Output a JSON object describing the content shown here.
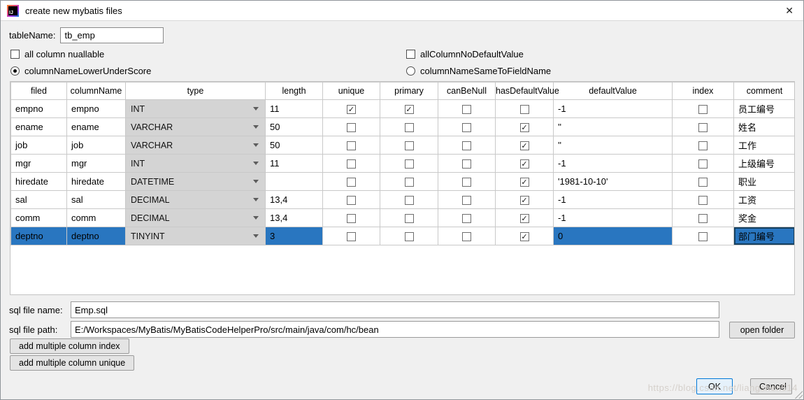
{
  "window": {
    "title": "create new mybatis files",
    "close_glyph": "✕"
  },
  "form": {
    "table_name_label": "tableName:",
    "table_name_value": "tb_emp",
    "options": {
      "all_nullable": "all column nuallable",
      "no_default": "allColumnNoDefaultValue",
      "lower_underscore": "columnNameLowerUnderScore",
      "same_to_field": "columnNameSameToFieldName"
    }
  },
  "table": {
    "headers": [
      "filed",
      "columnName",
      "type",
      "length",
      "unique",
      "primary",
      "canBeNull",
      "hasDefaultValue",
      "defaultValue",
      "index",
      "comment"
    ],
    "rows": [
      {
        "filed": "empno",
        "columnName": "empno",
        "type": "INT",
        "length": "11",
        "unique": true,
        "primary": true,
        "canBeNull": false,
        "hasDefaultValue": false,
        "defaultValue": "-1",
        "index": false,
        "comment": "员工编号",
        "selected": false
      },
      {
        "filed": "ename",
        "columnName": "ename",
        "type": "VARCHAR",
        "length": "50",
        "unique": false,
        "primary": false,
        "canBeNull": false,
        "hasDefaultValue": true,
        "defaultValue": "''",
        "index": false,
        "comment": "姓名",
        "selected": false
      },
      {
        "filed": "job",
        "columnName": "job",
        "type": "VARCHAR",
        "length": "50",
        "unique": false,
        "primary": false,
        "canBeNull": false,
        "hasDefaultValue": true,
        "defaultValue": "''",
        "index": false,
        "comment": "工作",
        "selected": false
      },
      {
        "filed": "mgr",
        "columnName": "mgr",
        "type": "INT",
        "length": "11",
        "unique": false,
        "primary": false,
        "canBeNull": false,
        "hasDefaultValue": true,
        "defaultValue": "-1",
        "index": false,
        "comment": "上级编号",
        "selected": false
      },
      {
        "filed": "hiredate",
        "columnName": "hiredate",
        "type": "DATETIME",
        "length": "",
        "unique": false,
        "primary": false,
        "canBeNull": false,
        "hasDefaultValue": true,
        "defaultValue": "'1981-10-10'",
        "index": false,
        "comment": "职业",
        "selected": false
      },
      {
        "filed": "sal",
        "columnName": "sal",
        "type": "DECIMAL",
        "length": "13,4",
        "unique": false,
        "primary": false,
        "canBeNull": false,
        "hasDefaultValue": true,
        "defaultValue": "-1",
        "index": false,
        "comment": "工资",
        "selected": false
      },
      {
        "filed": "comm",
        "columnName": "comm",
        "type": "DECIMAL",
        "length": "13,4",
        "unique": false,
        "primary": false,
        "canBeNull": false,
        "hasDefaultValue": true,
        "defaultValue": "-1",
        "index": false,
        "comment": "奖金",
        "selected": false
      },
      {
        "filed": "deptno",
        "columnName": "deptno",
        "type": "TINYINT",
        "length": "3",
        "unique": false,
        "primary": false,
        "canBeNull": false,
        "hasDefaultValue": true,
        "defaultValue": "0",
        "index": false,
        "comment": "部门编号",
        "selected": true
      }
    ]
  },
  "footer": {
    "sql_file_name_label": "sql file name:",
    "sql_file_name_value": "Emp.sql",
    "sql_file_path_label": "sql file path:",
    "sql_file_path_value": "E:/Workspaces/MyBatis/MyBatisCodeHelperPro/src/main/java/com/hc/bean",
    "open_folder": "open folder",
    "add_index": "add multiple column index",
    "add_unique": "add multiple column unique",
    "ok": "OK",
    "cancel": "Cancel",
    "watermark": "https://blog.csdn.net/liangshen514"
  }
}
